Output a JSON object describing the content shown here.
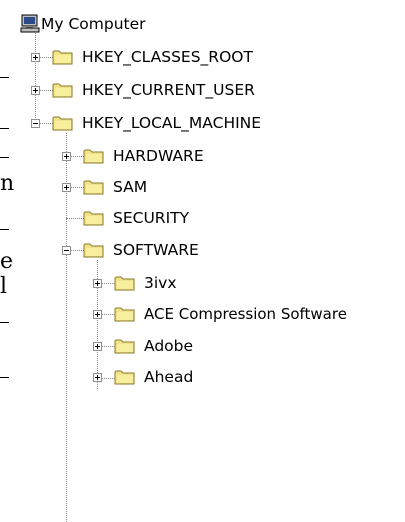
{
  "tree": {
    "root": {
      "label": "My Computer",
      "icon": "computer-icon"
    },
    "items": [
      {
        "label": "HKEY_CLASSES_ROOT",
        "expander": "plus",
        "icon": "folder-icon"
      },
      {
        "label": "HKEY_CURRENT_USER",
        "expander": "plus",
        "icon": "folder-icon"
      },
      {
        "label": "HKEY_LOCAL_MACHINE",
        "expander": "minus",
        "icon": "folder-icon"
      },
      {
        "label": "HARDWARE",
        "expander": "plus",
        "icon": "folder-icon"
      },
      {
        "label": "SAM",
        "expander": "plus",
        "icon": "folder-icon"
      },
      {
        "label": "SECURITY",
        "expander": "none",
        "icon": "folder-icon"
      },
      {
        "label": "SOFTWARE",
        "expander": "minus",
        "icon": "folder-icon"
      },
      {
        "label": "3ivx",
        "expander": "plus",
        "icon": "folder-icon"
      },
      {
        "label": "ACE Compression Software",
        "expander": "plus",
        "icon": "folder-icon"
      },
      {
        "label": "Adobe",
        "expander": "plus",
        "icon": "folder-icon"
      },
      {
        "label": "Ahead",
        "expander": "plus",
        "icon": "folder-icon"
      }
    ]
  },
  "margin": {
    "letter_n": "n",
    "letter_e": "e",
    "letter_l": "l"
  },
  "colors": {
    "folder": "#f2e28a",
    "folder_edge": "#8a7a2a",
    "tree_line": "#8a8a8a"
  }
}
